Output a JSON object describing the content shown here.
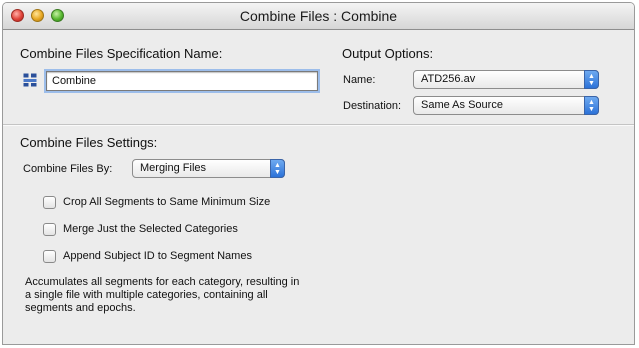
{
  "window": {
    "title": "Combine Files : Combine"
  },
  "spec": {
    "heading": "Combine Files Specification Name:",
    "name_value": "Combine"
  },
  "output": {
    "heading": "Output Options:",
    "name_label": "Name:",
    "name_value": "ATD256.av",
    "destination_label": "Destination:",
    "destination_value": "Same As Source"
  },
  "settings": {
    "heading": "Combine Files Settings:",
    "by_label": "Combine Files By:",
    "by_value": "Merging Files",
    "checkboxes": [
      {
        "label": "Crop All Segments to Same Minimum Size",
        "checked": false
      },
      {
        "label": "Merge Just the Selected Categories",
        "checked": false
      },
      {
        "label": "Append Subject ID to Segment Names",
        "checked": false
      }
    ],
    "description_lines": [
      "Accumulates all segments for each category, resulting in",
      "a single file with multiple categories, containing all",
      "segments and epochs."
    ]
  },
  "icons": {
    "close": "close-button",
    "minimize": "minimize-button",
    "zoom": "zoom-button",
    "spec": "combine-spec-icon",
    "popup": "updown-arrows-icon"
  }
}
